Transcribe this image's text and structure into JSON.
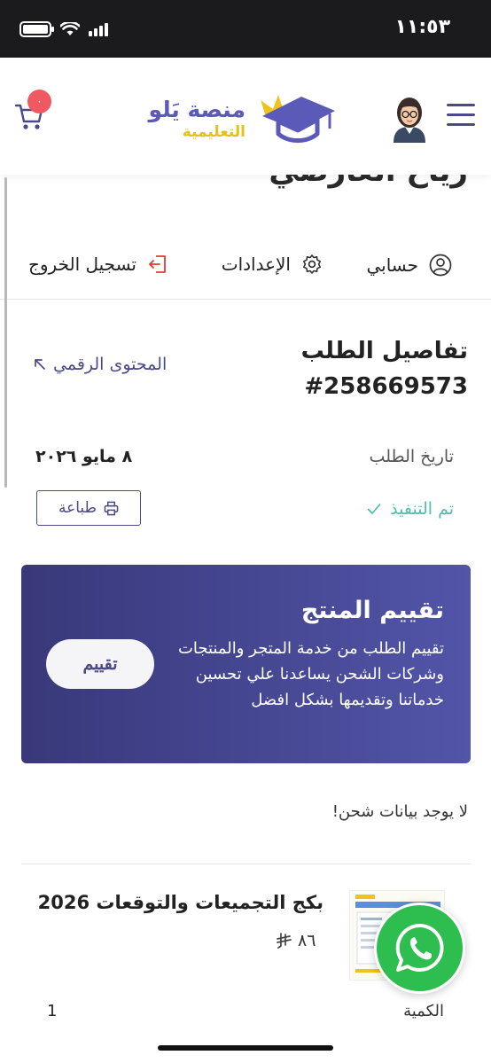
{
  "status_bar": {
    "time": "١١:٥٣"
  },
  "header": {
    "logo_name": "منصة يَلو",
    "logo_sub": "التعليمية",
    "cart_count": "٠"
  },
  "account": {
    "user_name": "رياح العارضي",
    "nav": {
      "my_account": "حسابي",
      "settings": "الإعدادات",
      "logout": "تسجيل الخروج"
    }
  },
  "order": {
    "title": "تفاصيل الطلب",
    "number": "#258669573",
    "digital_content_link": "المحتوى الرقمي",
    "date_label": "تاريخ الطلب",
    "date_value": "٨ مايو ٢٠٢٦",
    "print_label": "طباعة",
    "status": "تم التنفيذ"
  },
  "review_card": {
    "title": "تقييم المنتج",
    "text": "تقييم الطلب من خدمة المتجر والمنتجات وشركات الشحن يساعدنا علي تحسين خدماتنا وتقديمها بشكل افضل",
    "button": "تقييم"
  },
  "shipping": {
    "empty_message": "لا يوجد بيانات شحن!"
  },
  "product": {
    "name": "بكج التجميعات والتوقعات 2026",
    "price": "٨٦",
    "quantity_label": "الكمية",
    "quantity_value": "1"
  },
  "colors": {
    "brand": "#4a4a86",
    "status_done": "#4cbfae",
    "whatsapp": "#2ebd4f",
    "cart_badge": "#ef5a62"
  }
}
